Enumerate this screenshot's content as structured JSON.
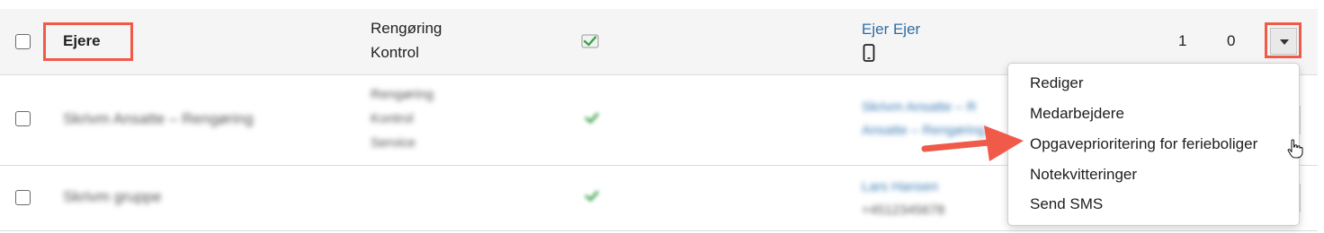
{
  "rows": [
    {
      "name": "Ejere",
      "types": [
        "Rengøring",
        "Kontrol"
      ],
      "contact_name": "Ejer Ejer",
      "count_a": "1",
      "count_b": "0"
    },
    {
      "name": "Skrivm Ansatte – Rengøring",
      "types": [
        "Rengøring",
        "Kontrol",
        "Service"
      ],
      "contact_lines": [
        "Skrivm Ansatte – R",
        "Ansatte – Rengøring"
      ]
    },
    {
      "name": "Skrivm gruppe",
      "contact_lines": [
        "Lars Hansen",
        "+4512345678"
      ]
    }
  ],
  "menu": {
    "items": [
      "Rediger",
      "Medarbejdere",
      "Opgaveprioritering for ferieboliger",
      "Notekvitteringer",
      "Send SMS"
    ]
  },
  "colors": {
    "highlight": "#ef5a49",
    "link": "#2e6da4",
    "check_green": "#3aa14a"
  },
  "icons": {
    "row_action": "chevron-down-icon",
    "contact_device": "mobile-phone-icon",
    "status": "check-icon",
    "cursor": "hand-pointer-icon"
  }
}
